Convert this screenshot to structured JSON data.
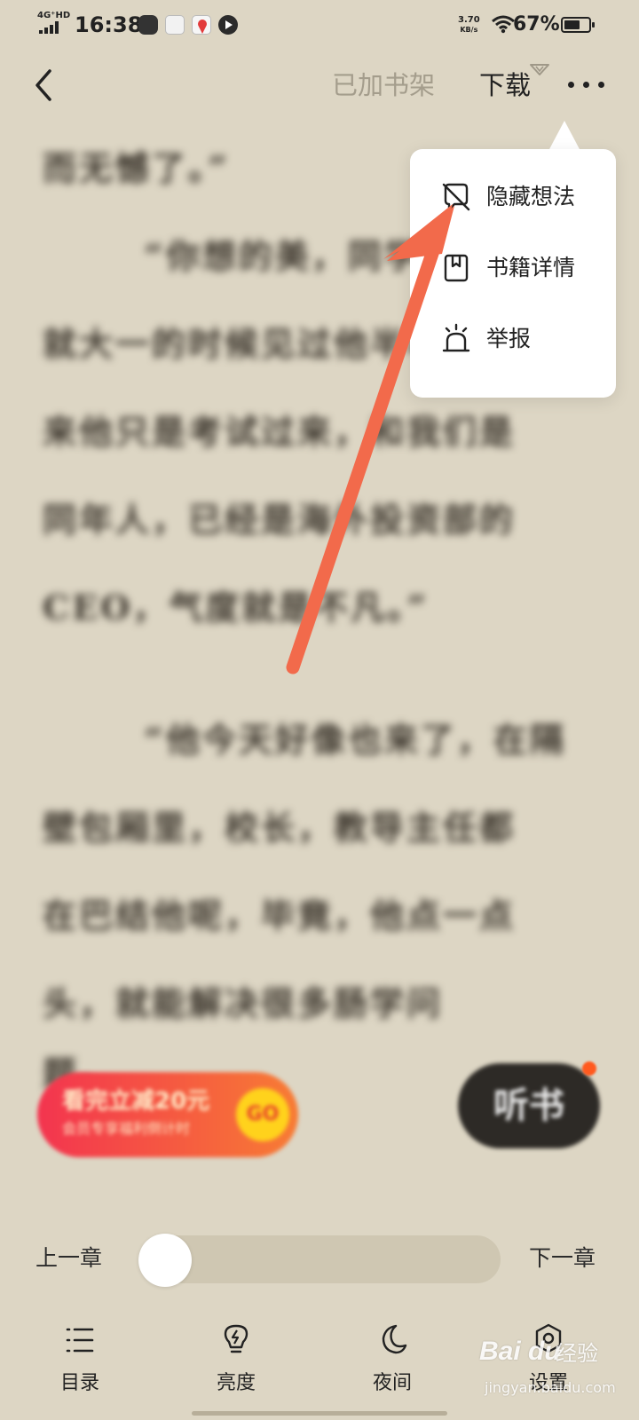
{
  "status_bar": {
    "network": "4G⁺HD",
    "time": "16:38",
    "speed_value": "3.70",
    "speed_unit": "KB/s",
    "battery": "67%",
    "battery_level": 0.67
  },
  "top_bar": {
    "shelf_label": "已加书架",
    "download_label": "下载"
  },
  "menu": {
    "items": [
      {
        "label": "隐藏想法",
        "icon": "hide-thoughts-icon"
      },
      {
        "label": "书籍详情",
        "icon": "book-details-icon"
      },
      {
        "label": "举报",
        "icon": "report-alarm-icon"
      }
    ]
  },
  "reader": {
    "lines": [
      "而无憾了。”",
      "“你想的美，同学",
      "就大一的时候见过他半年，后",
      "来他只是考试过来，和我们是",
      "同年人，已经是海外投资部的",
      "CEO，气度就是不凡。”",
      "",
      "“他今天好像也来了，在隔",
      "壁包厢里，校长，教导主任都",
      "在巴结他呢，毕竟，他点一点",
      "头，就能解决很多肠学问",
      "题。"
    ]
  },
  "promo": {
    "line1": "看完立减20元",
    "line2": "会员专享福利倒计时",
    "go": "GO"
  },
  "listen_label": "听书",
  "chapter_nav": {
    "prev": "上一章",
    "next": "下一章",
    "progress": 0
  },
  "tabs": [
    {
      "label": "目录",
      "icon": "toc-list-icon"
    },
    {
      "label": "亮度",
      "icon": "brightness-bulb-icon"
    },
    {
      "label": "夜间",
      "icon": "night-moon-icon"
    },
    {
      "label": "设置",
      "icon": "settings-gear-icon"
    }
  ],
  "watermark": {
    "logo": "Bai du",
    "text": "经验",
    "url": "jingyan.baidu.com"
  },
  "colors": {
    "background": "#ddd6c4",
    "arrow": "#f26a4b",
    "promo_start": "#f3344f",
    "promo_end": "#f77c34"
  }
}
